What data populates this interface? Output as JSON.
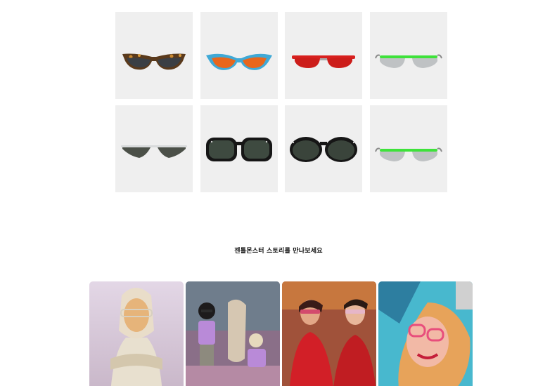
{
  "products": [
    {
      "id": "cat-eye-tortoise",
      "icon": "cat-eye-tortoise-sunglasses",
      "frame": "#5a3a1c",
      "lens": "#3b3f44"
    },
    {
      "id": "cat-eye-blue-orange",
      "icon": "cat-eye-blue-sunglasses",
      "frame": "#3fa9d6",
      "lens": "#e8661c"
    },
    {
      "id": "red-oval-red",
      "icon": "red-oval-sunglasses",
      "frame": "#d8201e",
      "lens": "#cc1d1a"
    },
    {
      "id": "green-bar-silver",
      "icon": "green-bar-sunglasses",
      "frame": "#3ee23a",
      "lens": "#bfc2c4"
    },
    {
      "id": "triangle-silver",
      "icon": "triangle-silver-sunglasses",
      "frame": "#d8dadb",
      "lens": "#4b5048"
    },
    {
      "id": "square-black",
      "icon": "square-black-sunglasses",
      "frame": "#161616",
      "lens": "#3e4a40"
    },
    {
      "id": "round-black",
      "icon": "round-black-sunglasses",
      "frame": "#161616",
      "lens": "#3a443b"
    },
    {
      "id": "green-bar-silver-2",
      "icon": "green-bar-sunglasses",
      "frame": "#3ee23a",
      "lens": "#bfc2c4"
    }
  ],
  "stories_section": {
    "heading": "젠틀몬스터 스토리를 만나보세요"
  }
}
